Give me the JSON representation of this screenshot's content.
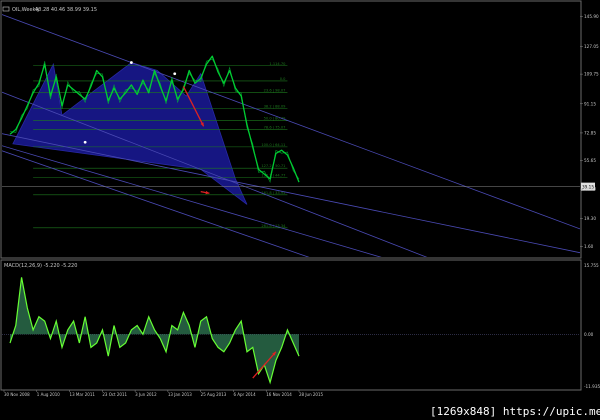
{
  "window": {
    "title": "OIL,Weekly",
    "ohlc": "40.28 40.46 38.99 39.15",
    "watermark": "[1269x848] https://upic.me/"
  },
  "colors": {
    "background": "#000000",
    "price_line": "#00cc33",
    "macd_fill": "#2a6b4a",
    "macd_line": "#66ff33",
    "pattern_fill": "#1a1a99",
    "trendline": "#4a4ab4",
    "fib_line": "#1e7a1e",
    "arrow": "#dd2222",
    "axis_text": "#c8c8c8",
    "current_price_bg": "#e0e0e0"
  },
  "chart_data": [
    {
      "type": "line",
      "name": "price",
      "ylim": [
        -5,
        155
      ],
      "y_ticks": [
        "145.90",
        "127.05",
        "109.75",
        "91.15",
        "72.85",
        "55.65",
        "37.60",
        "19.30",
        "1.60"
      ],
      "current_price": "39.15",
      "x_labels": [
        "30 Nov 2008",
        "1 Aug 2010",
        "13 Mar 2011",
        "23 Oct 2011",
        "3 Jun 2012",
        "13 Jan 2013",
        "25 Aug 2013",
        "6 Apr 2014",
        "16 Nov 2014",
        "28 Jun 2015"
      ],
      "x": [
        0,
        2,
        4,
        6,
        8,
        10,
        12,
        14,
        16,
        18,
        20,
        22,
        24,
        26,
        28,
        30,
        32,
        34,
        36,
        38,
        40,
        42,
        44,
        46,
        48,
        50,
        52,
        54,
        56,
        58,
        60,
        62,
        64,
        66,
        68,
        70,
        72,
        74,
        76,
        78,
        80,
        82,
        84,
        86,
        88,
        90,
        92,
        94,
        96,
        98,
        100
      ],
      "y": [
        72,
        75,
        82,
        90,
        98,
        104,
        116,
        96,
        108,
        90,
        103,
        100,
        97,
        94,
        102,
        112,
        108,
        93,
        101,
        94,
        98,
        103,
        97,
        106,
        98,
        112,
        102,
        93,
        106,
        94,
        100,
        112,
        104,
        107,
        116,
        121,
        111,
        104,
        112,
        101,
        96,
        78,
        64,
        50,
        47,
        44,
        60,
        62,
        59,
        51,
        42
      ],
      "pattern_polygon": [
        [
          1,
          66
        ],
        [
          15,
          116
        ],
        [
          18,
          84
        ],
        [
          42,
          117
        ],
        [
          51,
          112
        ],
        [
          61,
          96
        ],
        [
          66,
          110
        ],
        [
          78,
          44
        ],
        [
          82,
          28
        ],
        [
          66,
          50
        ]
      ],
      "fib_levels": [
        {
          "label": "1.114.70",
          "value": 115.0
        },
        {
          "label": "0.0",
          "value": 105.5
        },
        {
          "label": "23.6 | 98.07",
          "value": 98.1
        },
        {
          "label": "38.2 | 88.09",
          "value": 88.1
        },
        {
          "label": "50.0 | 80.49",
          "value": 80.5
        },
        {
          "label": "78.6 | 75.07",
          "value": 75.1
        },
        {
          "label": "100.0 | 64.11",
          "value": 64.1
        },
        {
          "label": "127.2 | 50.71",
          "value": 50.7
        },
        {
          "label": "138.2 | 44.77",
          "value": 44.8
        },
        {
          "label": "161.8 | 33.95",
          "value": 34.0
        },
        {
          "label": "261.8 | 13.34",
          "value": 13.3
        }
      ],
      "trendlines": [
        {
          "from": [
            42,
            117
          ],
          "to": [
            100,
            78
          ]
        },
        {
          "from": [
            -5,
            100
          ],
          "to": [
            100,
            26
          ]
        },
        {
          "from": [
            -5,
            66
          ],
          "to": [
            100,
            10
          ]
        },
        {
          "from": [
            -5,
            63
          ],
          "to": [
            100,
            -3
          ]
        },
        {
          "from": [
            25,
            62
          ],
          "to": [
            100,
            34
          ]
        }
      ],
      "markers": [
        [
          42,
          117
        ],
        [
          57,
          110
        ],
        [
          26,
          67
        ]
      ],
      "arrows": [
        {
          "from": [
            60,
            102
          ],
          "to": [
            67,
            77
          ]
        },
        {
          "from": [
            66,
            36
          ],
          "to": [
            69,
            35
          ]
        }
      ]
    },
    {
      "type": "area",
      "name": "MACD(12,26,9)",
      "label": "MACD(12,26,9) -5.220 -5.220",
      "ylim": [
        -12.5,
        16.5
      ],
      "y_ticks": [
        "15.755",
        "0.00",
        "-11.935"
      ],
      "zero": 0,
      "x": [
        0,
        2,
        4,
        6,
        8,
        10,
        12,
        14,
        16,
        18,
        20,
        22,
        24,
        26,
        28,
        30,
        32,
        34,
        36,
        38,
        40,
        42,
        44,
        46,
        48,
        50,
        52,
        54,
        56,
        58,
        60,
        62,
        64,
        66,
        68,
        70,
        72,
        74,
        76,
        78,
        80,
        82,
        84,
        86,
        88,
        90,
        92,
        94,
        96,
        98,
        100
      ],
      "y": [
        -2,
        2,
        13,
        6,
        1,
        4,
        3,
        -1,
        3,
        -3,
        1,
        3,
        -2,
        4,
        -3,
        -2,
        1,
        -5,
        2,
        -3,
        -2,
        1,
        2,
        0,
        4,
        1,
        -1,
        -4,
        2,
        1,
        5,
        2,
        -3,
        3,
        4,
        -1,
        -3,
        -4,
        -2,
        1,
        3,
        -4,
        -3,
        -9,
        -7,
        -11,
        -6,
        -3,
        1,
        -2,
        -5
      ]
    }
  ]
}
